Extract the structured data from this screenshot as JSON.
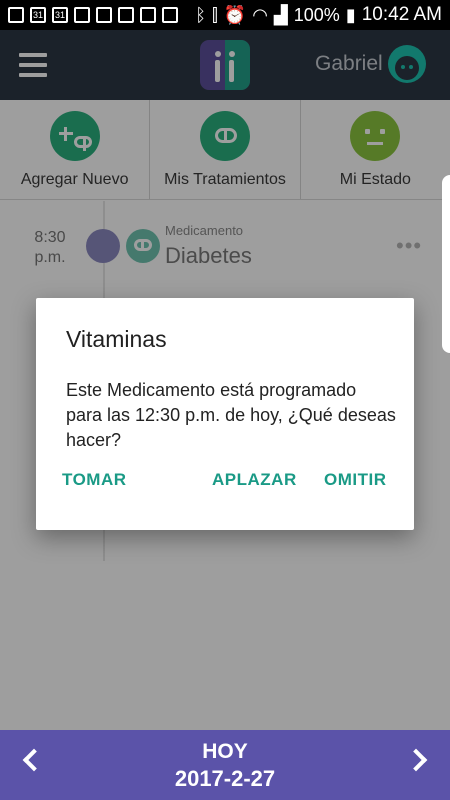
{
  "status_bar": {
    "left_icons": [
      "mail-icon",
      "calendar-icon",
      "calendar-icon",
      "keyboard-icon",
      "image-icon",
      "instagram-icon",
      "instagram-icon",
      "app-icon"
    ],
    "calendar_day": "31",
    "battery": "100%",
    "time": "10:42 AM"
  },
  "app_bar": {
    "username": "Gabriel"
  },
  "actions": {
    "add_new": "Agregar Nuevo",
    "my_treatments": "Mis Tratamientos",
    "my_status": "Mi Estado"
  },
  "timeline": [
    {
      "time": "8:30\np.m.",
      "kind": "Medicamento",
      "name": "Diabetes"
    }
  ],
  "dialog": {
    "title": "Vitaminas",
    "body": "Este Medicamento está programado para las 12:30 p.m. de hoy, ¿Qué deseas hacer?",
    "btn_take": "TOMAR",
    "btn_postpone": "APLAZAR",
    "btn_skip": "OMITIR"
  },
  "footer": {
    "today": "HOY",
    "date": "2017-2-27"
  },
  "colors": {
    "app_bar": "#2d3844",
    "accent": "#1a9a86",
    "footer": "#5b53a9"
  }
}
